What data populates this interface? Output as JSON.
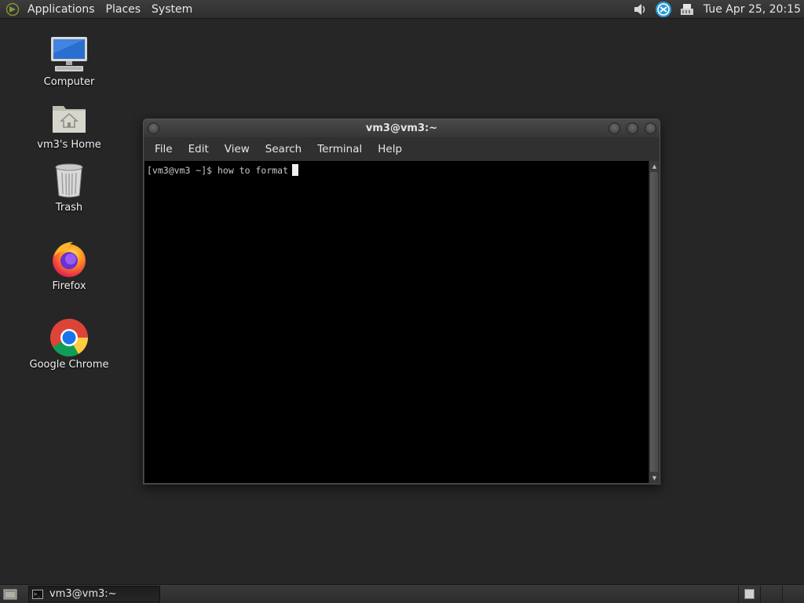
{
  "top_panel": {
    "menus": [
      "Applications",
      "Places",
      "System"
    ],
    "clock": "Tue Apr 25, 20:15",
    "tray_icons": [
      "volume-icon",
      "update-notifier-icon",
      "network-icon"
    ]
  },
  "desktop_icons": [
    {
      "label": "Computer",
      "icon": "computer-icon"
    },
    {
      "label": "vm3's Home",
      "icon": "home-folder-icon"
    },
    {
      "label": "Trash",
      "icon": "trash-icon"
    },
    {
      "label": "Firefox",
      "icon": "firefox-icon"
    },
    {
      "label": "Google Chrome",
      "icon": "chrome-icon"
    }
  ],
  "terminal": {
    "title": "vm3@vm3:~",
    "menu": [
      "File",
      "Edit",
      "View",
      "Search",
      "Terminal",
      "Help"
    ],
    "prompt": "[vm3@vm3 ~]$ how to format"
  },
  "taskbar": {
    "task_label": "vm3@vm3:~",
    "task_icon_text": ">_"
  },
  "colors": {
    "desktop_bg": "#262626",
    "panel_bg": "#333333",
    "terminal_bg": "#000000"
  }
}
